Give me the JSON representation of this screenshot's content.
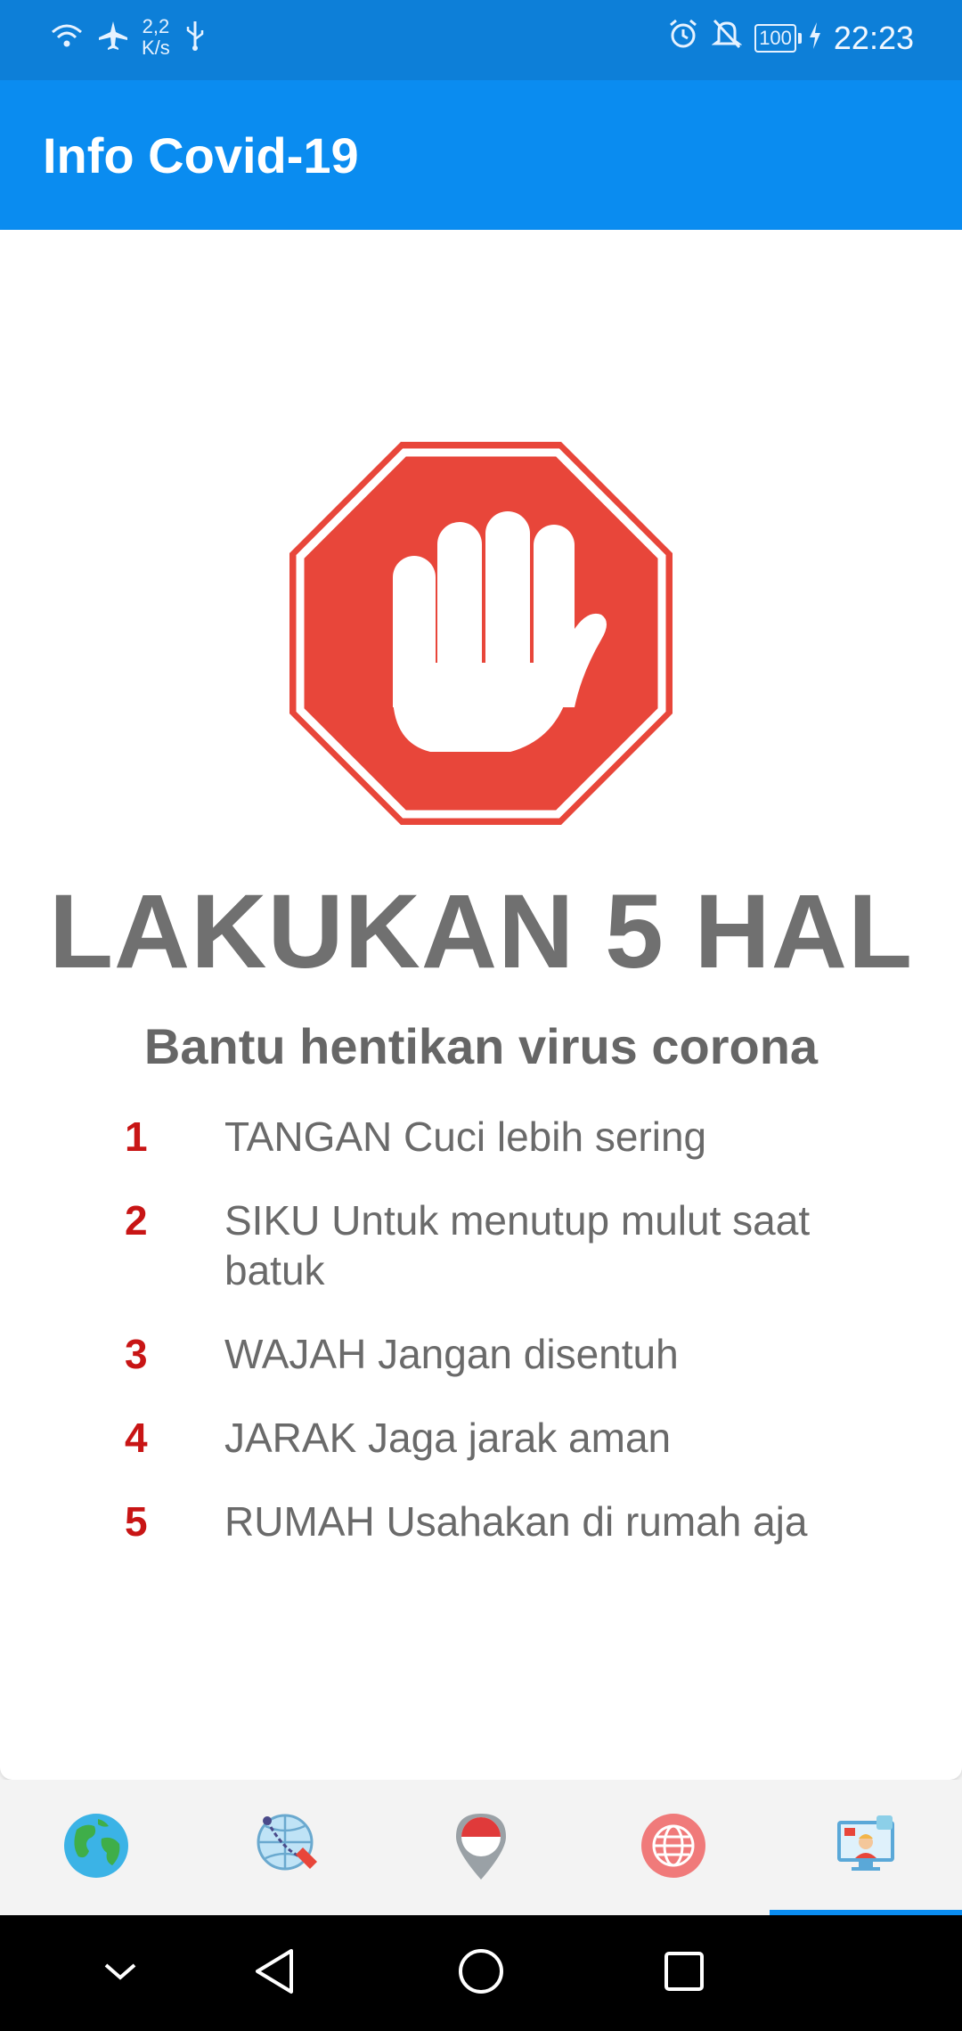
{
  "status_bar": {
    "network_speed_value": "2,2",
    "network_speed_unit": "K/s",
    "battery": "100",
    "time": "22:23",
    "icons": [
      "wifi-icon",
      "airplane-icon",
      "usb-icon",
      "alarm-icon",
      "bell-muted-icon",
      "battery-icon",
      "charging-icon"
    ]
  },
  "app_bar": {
    "title": "Info Covid-19"
  },
  "main": {
    "image_icon": "stop-hand-icon",
    "headline": "LAKUKAN 5 HAL",
    "subheadline": "Bantu hentikan virus corona",
    "steps": [
      {
        "number": "1",
        "text": "TANGAN Cuci lebih sering"
      },
      {
        "number": "2",
        "text": "SIKU Untuk menutup mulut saat batuk"
      },
      {
        "number": "3",
        "text": "WAJAH Jangan disentuh"
      },
      {
        "number": "4",
        "text": "JARAK Jaga jarak aman"
      },
      {
        "number": "5",
        "text": "RUMAH Usahakan di rumah aja"
      }
    ]
  },
  "bottom_nav": {
    "items": [
      {
        "icon": "globe-icon"
      },
      {
        "icon": "world-route-icon"
      },
      {
        "icon": "indonesia-pin-icon"
      },
      {
        "icon": "web-globe-icon"
      },
      {
        "icon": "online-info-icon"
      }
    ],
    "selected_index": 4
  },
  "colors": {
    "app_bar": "#0a8cf0",
    "status_bar": "#0d7fd8",
    "stop_red": "#e8463a",
    "step_number": "#c81515",
    "text_gray": "#6a6a6a"
  }
}
